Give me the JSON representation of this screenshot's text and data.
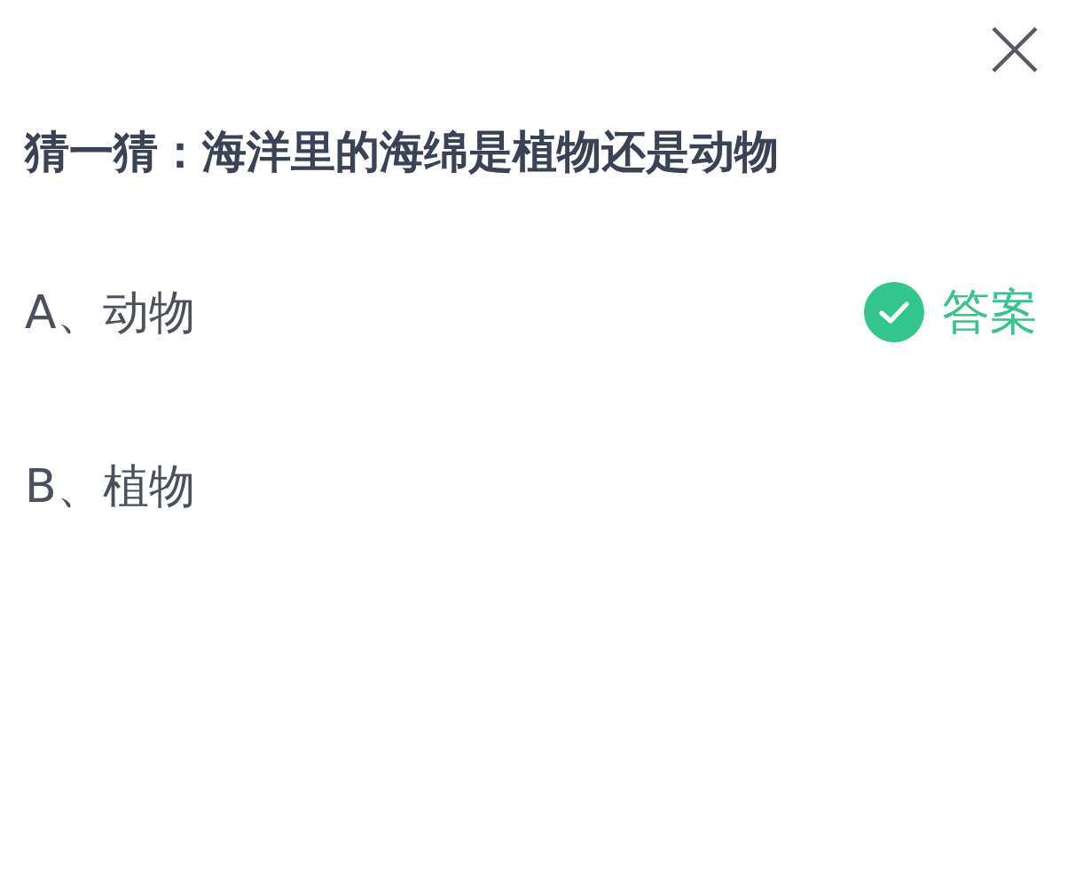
{
  "question": "猜一猜：海洋里的海绵是植物还是动物",
  "answer_badge": "答案",
  "options": [
    {
      "label": "A、动物",
      "correct": true
    },
    {
      "label": "B、植物",
      "correct": false
    }
  ]
}
